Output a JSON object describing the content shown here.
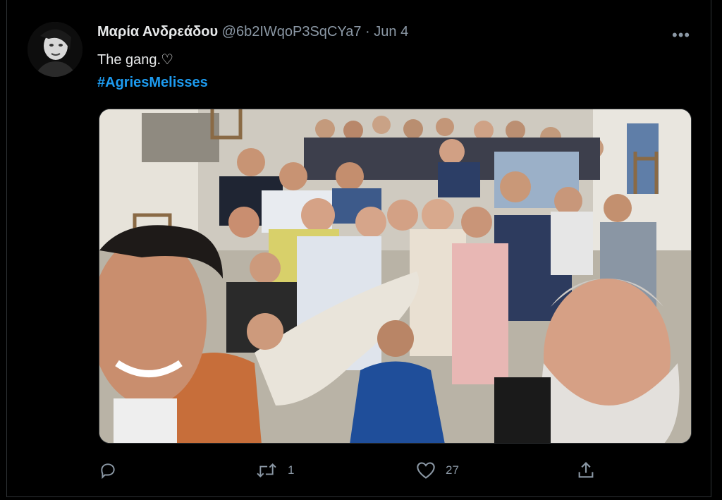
{
  "tweet": {
    "author_name": "Μαρία Ανδρεάδου",
    "handle": "@6b2IWqoP3SqCYa7",
    "separator": "·",
    "date": "Jun 4",
    "text": "The gang.♡",
    "hashtag": "#AgriesMelisses",
    "more_label": "•••"
  },
  "actions": {
    "reply_count": "",
    "retweet_count": "1",
    "like_count": "27"
  },
  "icons": {
    "reply": "reply-icon",
    "retweet": "retweet-icon",
    "like": "heart-icon",
    "share": "share-icon",
    "more": "more-icon"
  },
  "colors": {
    "background": "#000000",
    "text": "#e7e9ea",
    "secondary": "#8b98a5",
    "link": "#1d9bf0"
  }
}
